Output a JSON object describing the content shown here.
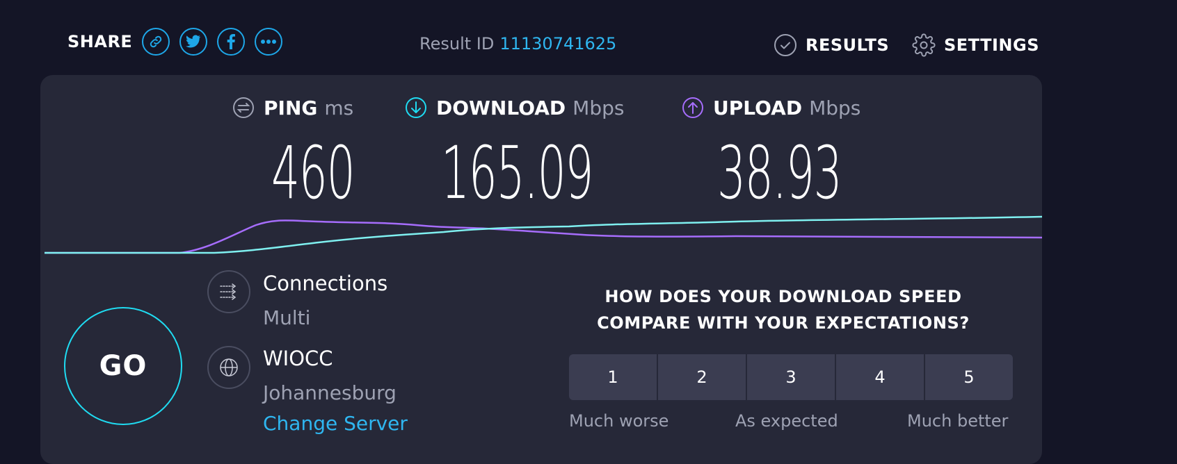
{
  "header": {
    "share_label": "SHARE",
    "share_icons": [
      "link-icon",
      "twitter-icon",
      "facebook-icon",
      "more-icon"
    ],
    "result_id_label": "Result ID",
    "result_id_value": "11130741625",
    "results_label": "RESULTS",
    "settings_label": "SETTINGS"
  },
  "metrics": {
    "ping": {
      "name": "PING",
      "unit": "ms",
      "value": "460"
    },
    "download": {
      "name": "DOWNLOAD",
      "unit": "Mbps",
      "value": "165.09"
    },
    "upload": {
      "name": "UPLOAD",
      "unit": "Mbps",
      "value": "38.93"
    }
  },
  "go_label": "GO",
  "connection": {
    "connections_label": "Connections",
    "connections_value": "Multi",
    "provider": "WIOCC",
    "location": "Johannesburg",
    "change_server": "Change Server"
  },
  "survey": {
    "question": "HOW DOES YOUR DOWNLOAD SPEED COMPARE WITH YOUR EXPECTATIONS?",
    "options": [
      "1",
      "2",
      "3",
      "4",
      "5"
    ],
    "low_label": "Much worse",
    "mid_label": "As expected",
    "high_label": "Much better"
  },
  "colors": {
    "accent": "#1ea7e8",
    "download": "#1fdcf2",
    "upload": "#a66dfc",
    "background": "#141526",
    "panel": "#262838"
  }
}
